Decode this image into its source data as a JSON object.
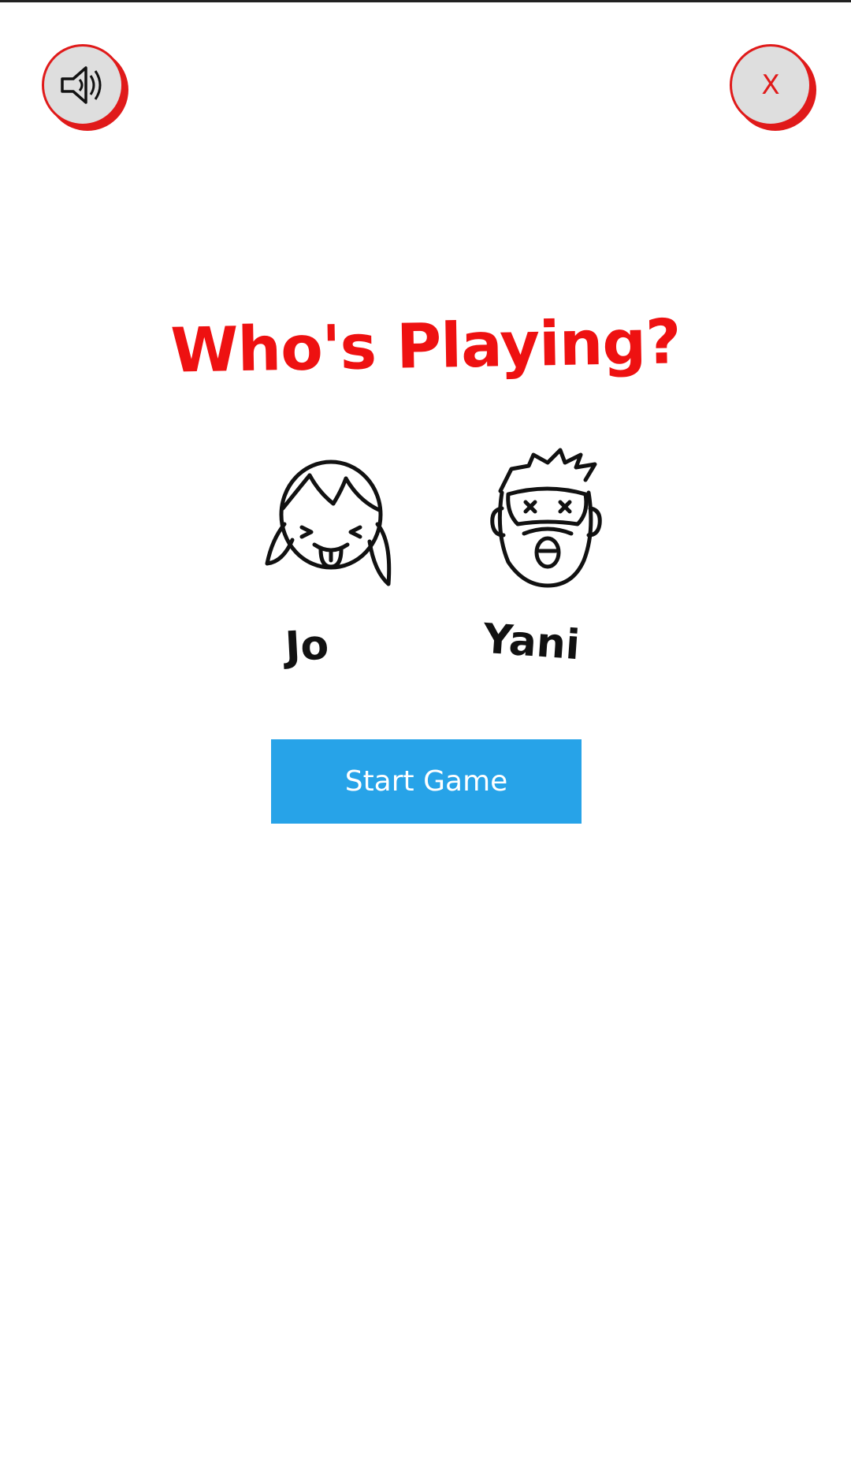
{
  "title": "Who's Playing?",
  "buttons": {
    "sound_icon": "speaker-icon",
    "close_label": "X",
    "start_label": "Start Game"
  },
  "players": [
    {
      "name": "Jo",
      "avatar_icon": "girl-face-tongue-icon"
    },
    {
      "name": "Yani",
      "avatar_icon": "bearded-man-face-icon"
    }
  ],
  "colors": {
    "accent_red": "#ee1111",
    "button_blue": "#27a3e8",
    "button_gray": "#dedede"
  }
}
